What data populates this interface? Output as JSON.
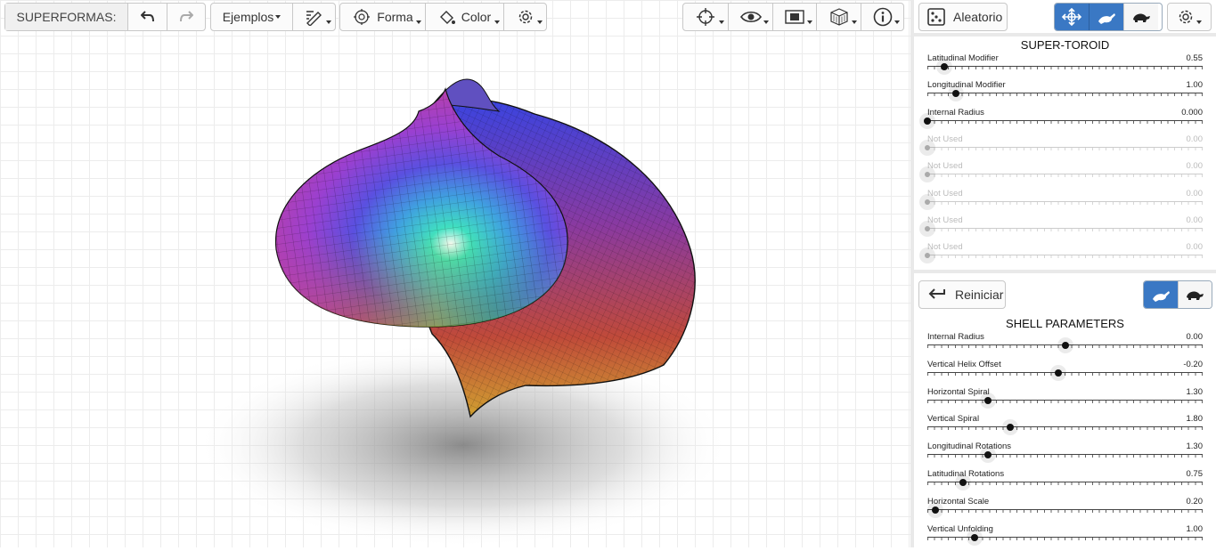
{
  "toolbar": {
    "app_label": "SUPERFORMAS:",
    "undo_icon": "undo-icon",
    "redo_icon": "redo-icon",
    "examples_label": "Ejemplos",
    "draw_icon": "pencil-edit-icon",
    "shape_label": "Forma",
    "color_label": "Color",
    "settings_icon": "gear-icon",
    "right_icons": [
      "crosshair-icon",
      "eye-icon",
      "display-mode-icon",
      "cube-icon",
      "info-icon"
    ]
  },
  "panel": {
    "random_label": "Aleatorio",
    "modes": [
      "move-icon",
      "hare-icon",
      "turtle-icon"
    ],
    "settings_icon": "gear-icon",
    "super_toroid": {
      "title": "SUPER-TOROID",
      "sliders": [
        {
          "label": "Latitudinal Modifier",
          "value": "0.55",
          "pos": 0.06,
          "disabled": false
        },
        {
          "label": "Longitudinal Modifier",
          "value": "1.00",
          "pos": 0.105,
          "disabled": false
        },
        {
          "label": "Internal Radius",
          "value": "0.000",
          "pos": 0.0,
          "disabled": false
        },
        {
          "label": "Not Used",
          "value": "0.00",
          "pos": 0.0,
          "disabled": true
        },
        {
          "label": "Not Used",
          "value": "0.00",
          "pos": 0.0,
          "disabled": true
        },
        {
          "label": "Not Used",
          "value": "0.00",
          "pos": 0.0,
          "disabled": true
        },
        {
          "label": "Not Used",
          "value": "0.00",
          "pos": 0.0,
          "disabled": true
        },
        {
          "label": "Not Used",
          "value": "0.00",
          "pos": 0.0,
          "disabled": true
        }
      ]
    },
    "reset_label": "Reiniciar",
    "shell": {
      "title": "SHELL PARAMETERS",
      "sliders": [
        {
          "label": "Internal Radius",
          "value": "0.00",
          "pos": 0.5,
          "disabled": false
        },
        {
          "label": "Vertical Helix Offset",
          "value": "-0.20",
          "pos": 0.475,
          "disabled": false
        },
        {
          "label": "Horizontal Spiral",
          "value": "1.30",
          "pos": 0.22,
          "disabled": false
        },
        {
          "label": "Vertical Spiral",
          "value": "1.80",
          "pos": 0.3,
          "disabled": false
        },
        {
          "label": "Longitudinal Rotations",
          "value": "1.30",
          "pos": 0.22,
          "disabled": false
        },
        {
          "label": "Latitudinal Rotations",
          "value": "0.75",
          "pos": 0.13,
          "disabled": false
        },
        {
          "label": "Horizontal Scale",
          "value": "0.20",
          "pos": 0.03,
          "disabled": false
        },
        {
          "label": "Vertical Unfolding",
          "value": "1.00",
          "pos": 0.17,
          "disabled": false
        }
      ]
    }
  },
  "colors": {
    "accent": "#3a78c4"
  }
}
